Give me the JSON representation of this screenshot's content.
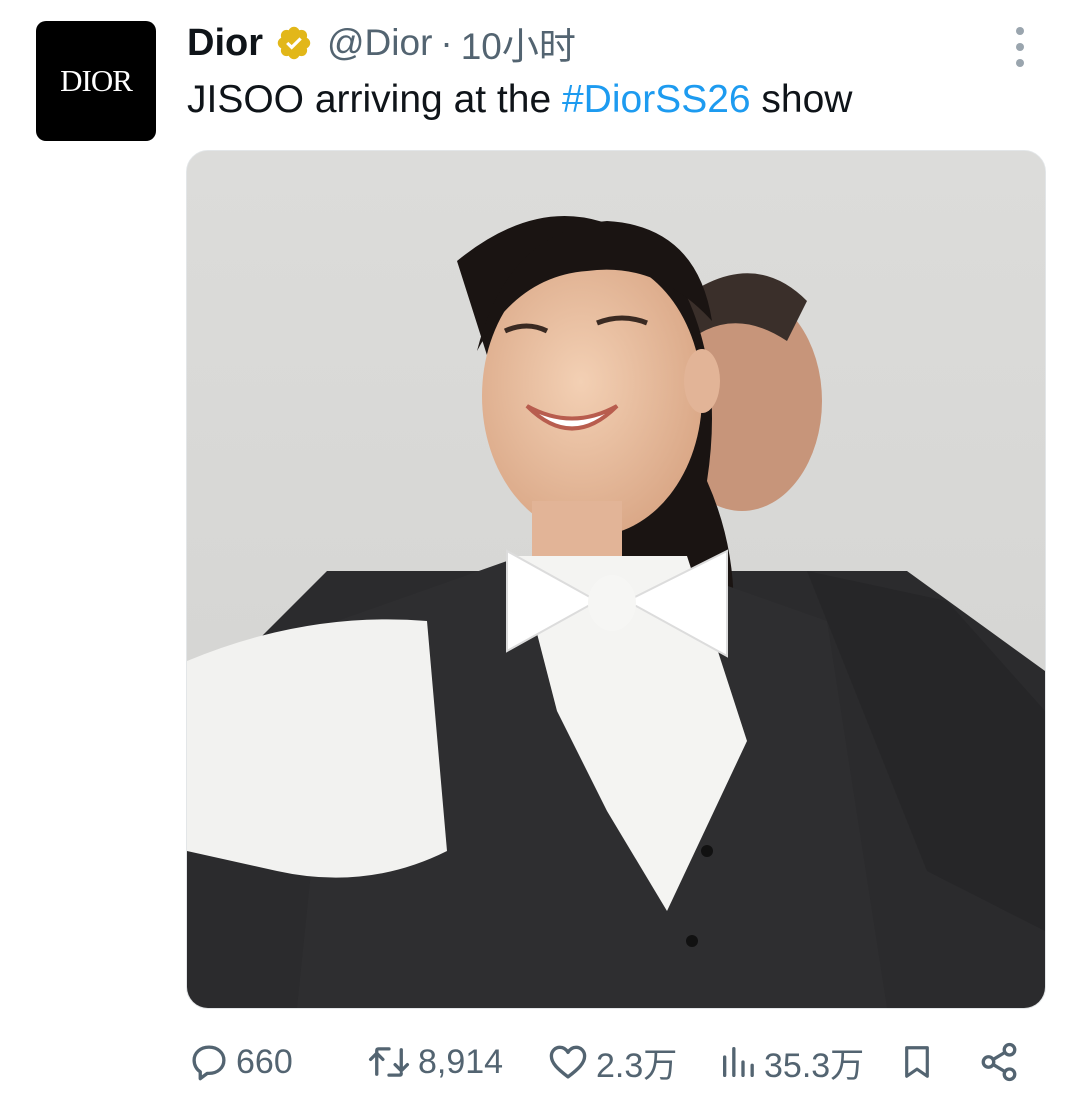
{
  "author": {
    "avatar_text": "DIOR",
    "name": "Dior",
    "handle": "@Dior",
    "separator": "·",
    "time": "10小时",
    "verified_badge": "gold-checkmark-icon"
  },
  "tweet": {
    "text_before": "JISOO arriving at the ",
    "hashtag": "#DiorSS26",
    "text_after": " show"
  },
  "media": {
    "type": "video",
    "mute_icon": "volume-muted-icon"
  },
  "actions": {
    "replies": "660",
    "retweets": "8,914",
    "likes": "2.3万",
    "views": "35.3万"
  },
  "colors": {
    "accent": "#1d9bf0",
    "text_secondary": "#536471",
    "verified_gold": "#e2b719"
  }
}
